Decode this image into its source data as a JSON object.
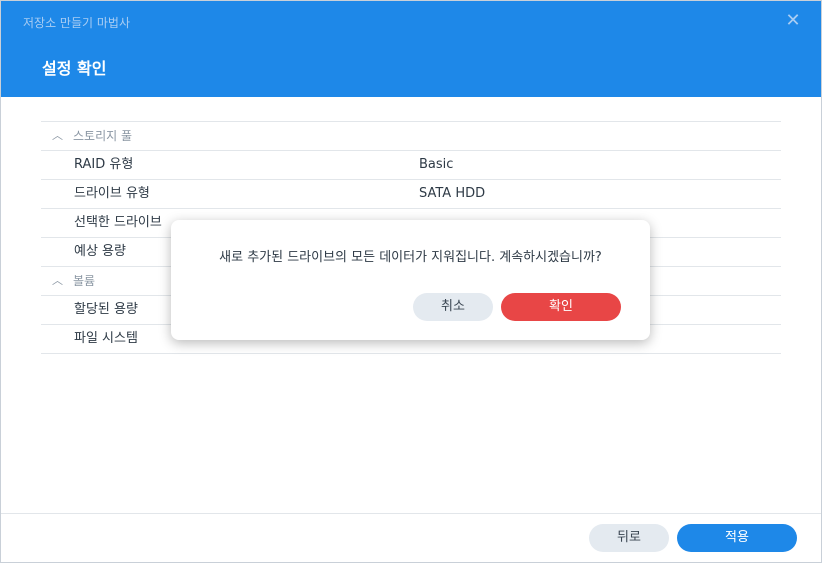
{
  "window": {
    "title": "저장소 만들기 마법사",
    "close_glyph": "✕",
    "step_title": "설정 확인"
  },
  "sections": [
    {
      "label": "스토리지 풀",
      "icon": "chevron-up-icon",
      "rows": [
        {
          "key": "RAID 유형",
          "value": "Basic"
        },
        {
          "key": "드라이브 유형",
          "value": "SATA HDD"
        },
        {
          "key": "선택한 드라이브",
          "value": ""
        },
        {
          "key": "예상 용량",
          "value": ""
        }
      ]
    },
    {
      "label": "볼륨",
      "icon": "chevron-up-icon",
      "rows": [
        {
          "key": "할당된 용량",
          "value": ""
        },
        {
          "key": "파일 시스템",
          "value": ""
        }
      ]
    }
  ],
  "footer": {
    "back_label": "뒤로",
    "apply_label": "적용"
  },
  "dialog": {
    "message": "새로 추가된 드라이브의 모든 데이터가 지워집니다. 계속하시겠습니까?",
    "cancel_label": "취소",
    "confirm_label": "확인"
  },
  "colors": {
    "header_bg": "#1e88e8",
    "primary_button": "#1e88e8",
    "danger_button": "#e84646",
    "secondary_button": "#e4eaf0"
  }
}
